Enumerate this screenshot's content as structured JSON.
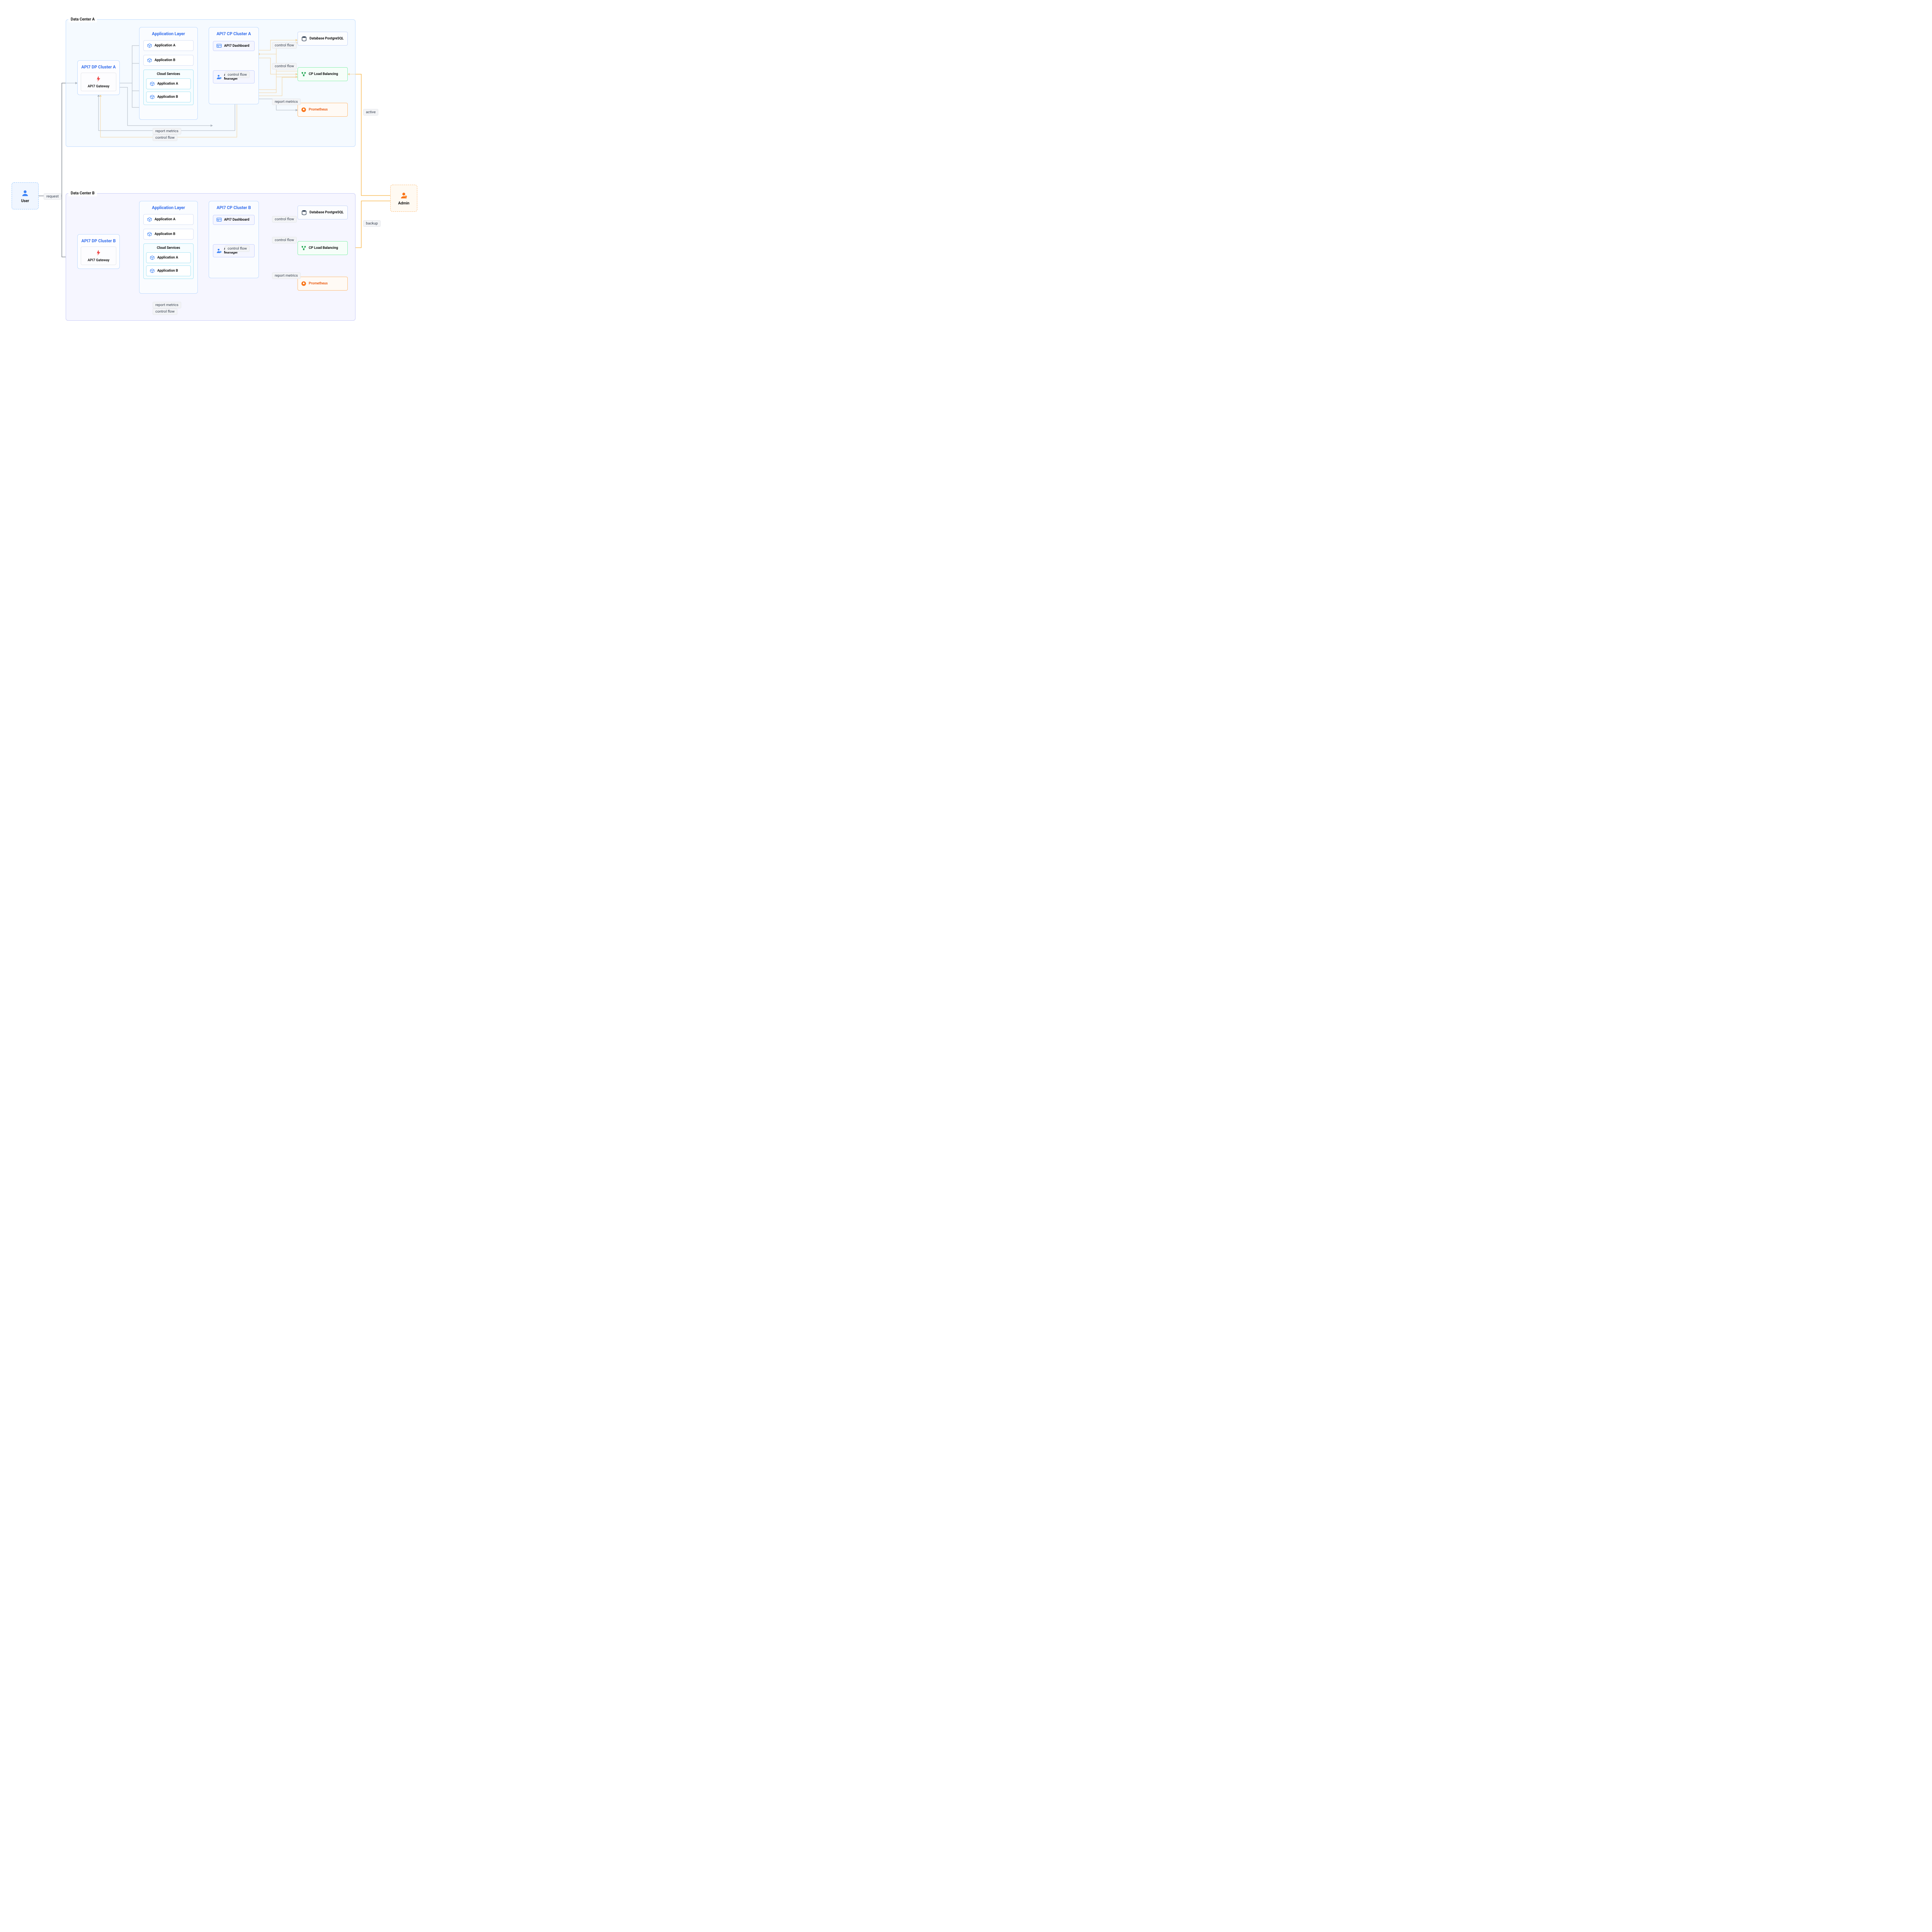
{
  "actors": {
    "user": "User",
    "admin": "Admin"
  },
  "datacenterA": {
    "title": "Data Center A",
    "dpCluster": {
      "title": "API7 DP Cluster A",
      "gateway": "API7 Gateway"
    },
    "appLayer": {
      "title": "Application Layer",
      "apps": [
        "Application A",
        "Application B"
      ],
      "cloudTitle": "Cloud Services",
      "cloudApps": [
        "Application A",
        "Application B"
      ]
    },
    "cpCluster": {
      "title": "API7 CP Cluster A",
      "dashboard": "API7 Dashboard",
      "dpManager": "API7 DP Manager"
    },
    "services": {
      "db": "Database PostgreSQL",
      "lb": "CP Load Balancing",
      "prom": "Prometheus"
    }
  },
  "datacenterB": {
    "title": "Data Center B",
    "dpCluster": {
      "title": "API7 DP Cluster B",
      "gateway": "API7 Gateway"
    },
    "appLayer": {
      "title": "Application Layer",
      "apps": [
        "Application A",
        "Application B"
      ],
      "cloudTitle": "Cloud Services",
      "cloudApps": [
        "Application A",
        "Application B"
      ]
    },
    "cpCluster": {
      "title": "API7 CP Cluster B",
      "dashboard": "API7 Dashboard",
      "dpManager": "API7 DP Manager"
    },
    "services": {
      "db": "Database PostgreSQL",
      "lb": "CP Load Balancing",
      "prom": "Prometheus"
    }
  },
  "labels": {
    "request": "request",
    "controlFlow": "control flow",
    "reportMetrics": "report metrics",
    "active": "active",
    "backup": "backup"
  }
}
